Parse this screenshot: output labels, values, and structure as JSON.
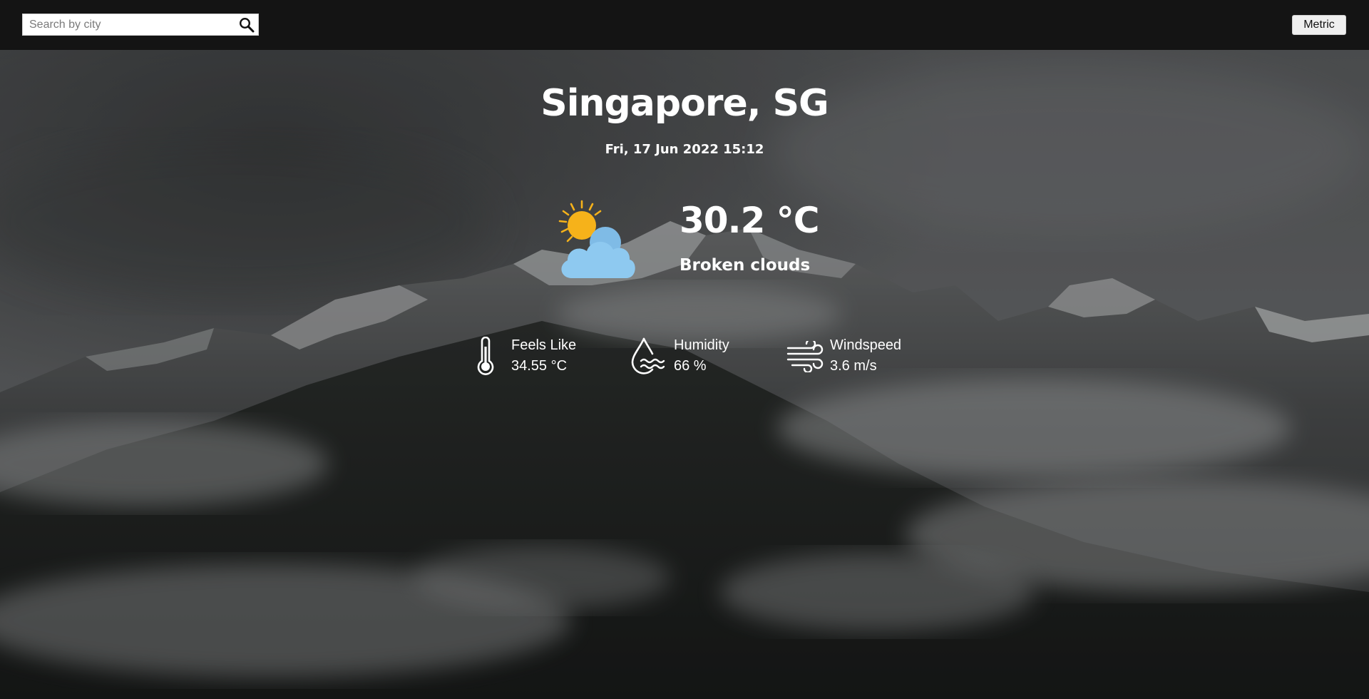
{
  "search": {
    "placeholder": "Search by city",
    "value": ""
  },
  "units_button": {
    "label": "Metric"
  },
  "location": {
    "city": "Singapore, SG",
    "datetime": "Fri, 17 Jun 2022 15:12"
  },
  "current": {
    "temperature": "30.2 °C",
    "condition": "Broken clouds",
    "icon": "sun-behind-cloud-icon"
  },
  "stats": {
    "feels_like": {
      "label": "Feels Like",
      "value": "34.55 °C",
      "icon": "thermometer-icon"
    },
    "humidity": {
      "label": "Humidity",
      "value": "66 %",
      "icon": "humidity-drop-icon"
    },
    "windspeed": {
      "label": "Windspeed",
      "value": "3.6 m/s",
      "icon": "wind-icon"
    }
  },
  "colors": {
    "topbar": "#141414",
    "sun": "#f6b21a",
    "cloud": "#8ec9f0",
    "text": "#ffffff"
  }
}
